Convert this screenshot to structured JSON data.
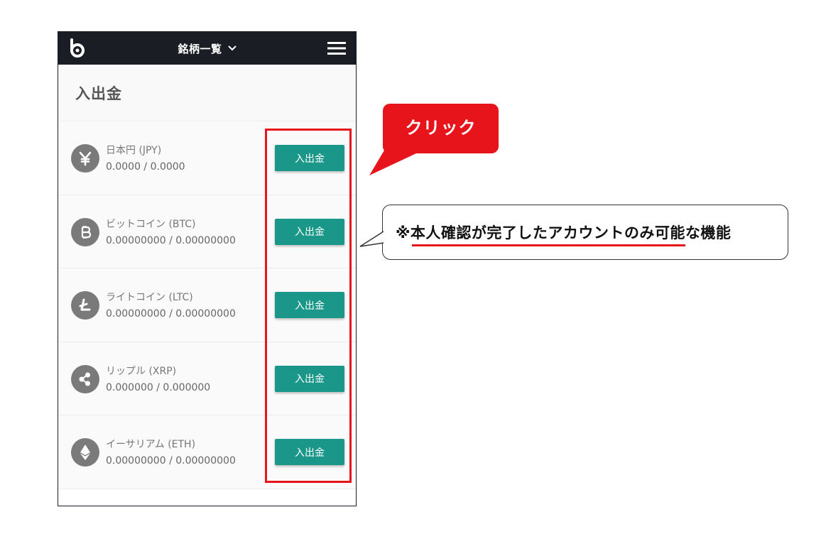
{
  "nav": {
    "title": "銘柄一覧"
  },
  "page": {
    "title": "入出金"
  },
  "assets": [
    {
      "name": "日本円 (JPY)",
      "balance": "0.0000 / 0.0000",
      "icon": "yen-icon",
      "button": "入出金"
    },
    {
      "name": "ビットコイン (BTC)",
      "balance": "0.00000000 / 0.00000000",
      "icon": "bitcoin-icon",
      "button": "入出金"
    },
    {
      "name": "ライトコイン (LTC)",
      "balance": "0.00000000 / 0.00000000",
      "icon": "litecoin-icon",
      "button": "入出金"
    },
    {
      "name": "リップル (XRP)",
      "balance": "0.000000 / 0.000000",
      "icon": "ripple-icon",
      "button": "入出金"
    },
    {
      "name": "イーサリアム (ETH)",
      "balance": "0.00000000 / 0.00000000",
      "icon": "ethereum-icon",
      "button": "入出金"
    }
  ],
  "annotations": {
    "click_label": "クリック",
    "note": "※本人確認が完了したアカウントのみ可能な機能"
  },
  "colors": {
    "navbar": "#1a1d23",
    "button": "#1a9788",
    "highlight": "#e8141b"
  }
}
